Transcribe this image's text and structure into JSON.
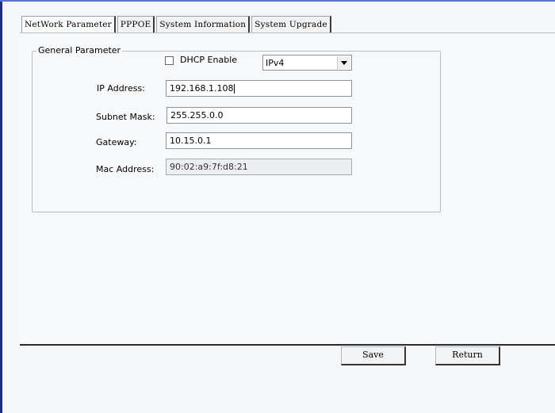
{
  "tabs": [
    {
      "label": "NetWork Parameter",
      "active": true
    },
    {
      "label": "PPPOE",
      "active": false
    },
    {
      "label": "System Information",
      "active": false
    },
    {
      "label": "System Upgrade",
      "active": false
    }
  ],
  "general_parameter": {
    "legend": "General Parameter",
    "dhcp_label": "DHCP Enable",
    "dhcp_checked": false,
    "ip_version": "IPv4",
    "ip_address_label": "IP Address:",
    "ip_address_value": "192.168.1.108",
    "subnet_mask_label": "Subnet Mask:",
    "subnet_mask_value": "255.255.0.0",
    "gateway_label": "Gateway:",
    "gateway_value": "10.15.0.1",
    "mac_address_label": "Mac Address:",
    "mac_address_value": "90:02:a9:7f:d8:21"
  },
  "buttons": {
    "save_label": "Save",
    "return_label": "Return"
  }
}
